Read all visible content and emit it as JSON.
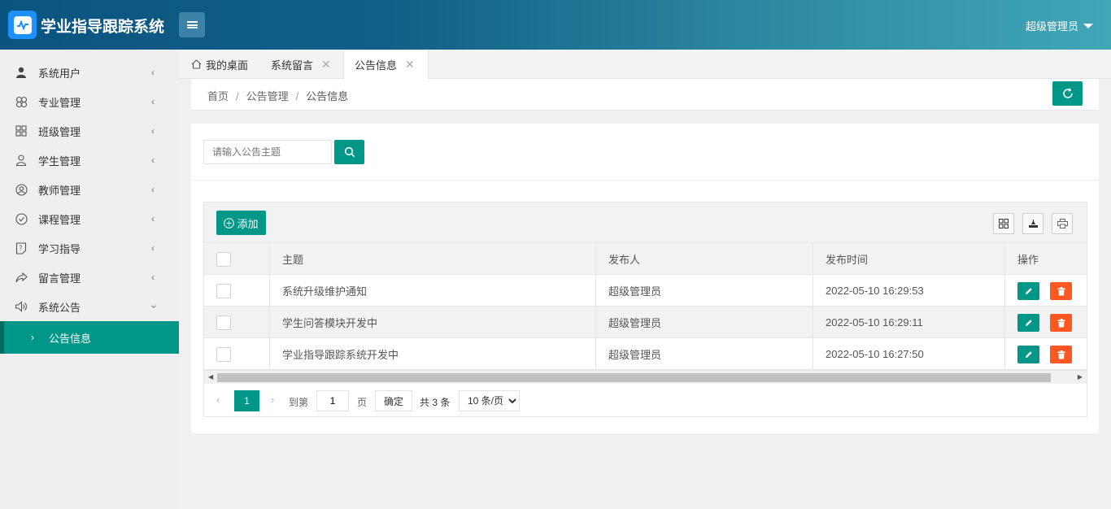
{
  "header": {
    "app_title": "学业指导跟踪系统",
    "user_label": "超级管理员",
    "logo_icon": "pulse-chart-icon",
    "accent": "#009688",
    "header_gradient": [
      "#0a5580",
      "#42a6b7"
    ]
  },
  "sidebar": {
    "items": [
      {
        "label": "系统用户",
        "icon": "user-icon"
      },
      {
        "label": "专业管理",
        "icon": "clover-icon"
      },
      {
        "label": "班级管理",
        "icon": "grid-icon"
      },
      {
        "label": "学生管理",
        "icon": "users-icon"
      },
      {
        "label": "教师管理",
        "icon": "user-circle-icon"
      },
      {
        "label": "课程管理",
        "icon": "check-circle-icon"
      },
      {
        "label": "学习指导",
        "icon": "help-doc-icon"
      },
      {
        "label": "留言管理",
        "icon": "share-icon"
      },
      {
        "label": "系统公告",
        "icon": "speaker-icon"
      }
    ],
    "active_sub": {
      "label": "公告信息"
    }
  },
  "tabs": [
    {
      "label": "我的桌面",
      "icon": "home-icon",
      "closable": false
    },
    {
      "label": "系统留言",
      "closable": true
    },
    {
      "label": "公告信息",
      "closable": true,
      "active": true
    }
  ],
  "breadcrumb": {
    "items": [
      "首页",
      "公告管理",
      "公告信息"
    ],
    "separator": "/"
  },
  "search": {
    "placeholder": "请输入公告主题"
  },
  "toolbar": {
    "add_label": "添加"
  },
  "table": {
    "columns": [
      "主题",
      "发布人",
      "发布时间",
      "操作"
    ],
    "rows": [
      {
        "title": "系统升级维护通知",
        "publisher": "超级管理员",
        "time": "2022-05-10 16:29:53"
      },
      {
        "title": "学生问答模块开发中",
        "publisher": "超级管理员",
        "time": "2022-05-10 16:29:11"
      },
      {
        "title": "学业指导跟踪系统开发中",
        "publisher": "超级管理员",
        "time": "2022-05-10 16:27:50"
      }
    ]
  },
  "pager": {
    "current_page": "1",
    "goto_label": "到第",
    "page_input": "1",
    "page_unit": "页",
    "confirm_label": "确定",
    "total_label": "共 3 条",
    "page_size_options": [
      "10 条/页"
    ],
    "page_size_selected": "10 条/页"
  }
}
